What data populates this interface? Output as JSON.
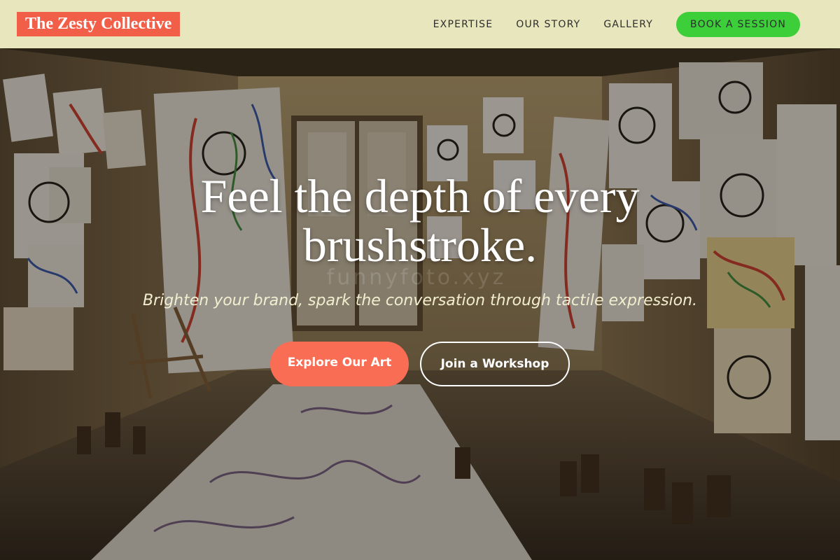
{
  "header": {
    "logo": "The Zesty Collective",
    "nav": [
      {
        "label": "EXPERTISE"
      },
      {
        "label": "OUR STORY"
      },
      {
        "label": "GALLERY"
      }
    ],
    "cta_label": "BOOK A SESSION"
  },
  "hero": {
    "headline": "Feel the depth of every brushstroke.",
    "subheadline": "Brighten your brand, spark the conversation through tactile expression.",
    "primary_button": "Explore Our Art",
    "secondary_button": "Join a Workshop",
    "watermark": "funnyfoto.xyz",
    "background_image": "art-studio-room-photo"
  },
  "colors": {
    "header_bg": "#e8e6bd",
    "logo_bg": "#f25f49",
    "cta_green": "#3ccf3a",
    "primary_coral": "#f96d54"
  }
}
